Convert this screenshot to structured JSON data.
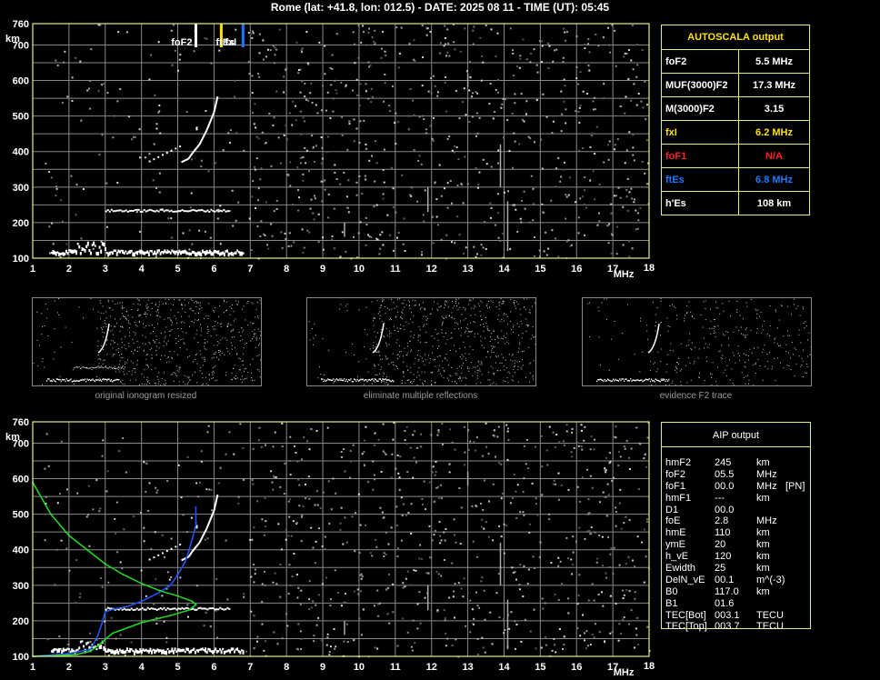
{
  "header": {
    "text": "Rome (lat: +41.8, lon: 012.5) - DATE: 2025 08 11 - TIME (UT): 05:45"
  },
  "colors": {
    "grid": "#888888",
    "frame": "#e6f07a",
    "trace": "#ffffff",
    "foF2": "#ffffff",
    "fxI": "#ffe100",
    "ftEs": "#1e78ff",
    "model": "#22dd22",
    "profile": "#2255ff"
  },
  "chart_data": [
    {
      "type": "scatter",
      "id": "ionogram-top",
      "xlabel": "MHz",
      "ylabel": "km",
      "xlim": [
        1,
        18
      ],
      "ylim": [
        100,
        760
      ],
      "x_ticks": [
        "1",
        "2",
        "3",
        "4",
        "5",
        "6",
        "7",
        "8",
        "9",
        "10",
        "11",
        "12",
        "13",
        "14",
        "15",
        "16",
        "17",
        "18"
      ],
      "y_ticks": [
        "100",
        "200",
        "300",
        "400",
        "500",
        "600",
        "700",
        "760"
      ],
      "markers": [
        {
          "label": "foF2",
          "x": 5.5,
          "color": "#ffffff"
        },
        {
          "label": "fxI",
          "x": 6.2,
          "color": "#ffe100"
        },
        {
          "label": "ftEs",
          "x": 6.8,
          "color": "#1e78ff"
        }
      ],
      "traces": {
        "es_layer": {
          "x_start": 1.5,
          "x_end": 6.8,
          "height_km": 120
        },
        "es_multiple": {
          "x_start": 3.0,
          "x_end": 6.4,
          "height_km": 236
        },
        "f2_trace": [
          [
            5.1,
            370
          ],
          [
            5.3,
            380
          ],
          [
            5.4,
            395
          ],
          [
            5.6,
            420
          ],
          [
            5.8,
            460
          ],
          [
            6.0,
            510
          ],
          [
            6.1,
            555
          ]
        ],
        "f2_lower": [
          [
            5.0,
            480
          ],
          [
            4.8,
            440
          ],
          [
            4.6,
            410
          ],
          [
            4.4,
            395
          ],
          [
            4.3,
            385
          ],
          [
            4.2,
            380
          ]
        ]
      }
    },
    {
      "type": "scatter",
      "id": "ionogram-bottom",
      "xlabel": "MHz",
      "ylabel": "km",
      "xlim": [
        1,
        18
      ],
      "ylim": [
        100,
        760
      ],
      "x_ticks": [
        "1",
        "2",
        "3",
        "4",
        "5",
        "6",
        "7",
        "8",
        "9",
        "10",
        "11",
        "12",
        "13",
        "14",
        "15",
        "16",
        "17",
        "18"
      ],
      "y_ticks": [
        "100",
        "200",
        "300",
        "400",
        "500",
        "600",
        "700",
        "760"
      ],
      "series": [
        {
          "name": "",
          "color": "#2255ff",
          "points": [
            [
              1.0,
              100
            ],
            [
              2.0,
              108
            ],
            [
              2.6,
              120
            ],
            [
              2.8,
              160
            ],
            [
              2.9,
              190
            ],
            [
              3.0,
              225
            ],
            [
              3.2,
              232
            ],
            [
              3.6,
              240
            ],
            [
              4.0,
              255
            ],
            [
              4.4,
              275
            ],
            [
              4.8,
              300
            ],
            [
              5.0,
              330
            ],
            [
              5.2,
              365
            ],
            [
              5.3,
              395
            ],
            [
              5.4,
              430
            ],
            [
              5.5,
              470
            ],
            [
              5.5,
              520
            ]
          ]
        },
        {
          "name": "",
          "color": "#22dd22",
          "points": [
            [
              1.0,
              590
            ],
            [
              1.5,
              500
            ],
            [
              2.0,
              440
            ],
            [
              2.5,
              400
            ],
            [
              3.0,
              360
            ],
            [
              3.5,
              330
            ],
            [
              4.0,
              305
            ],
            [
              4.5,
              285
            ],
            [
              5.0,
              270
            ],
            [
              5.4,
              255
            ],
            [
              5.5,
              245
            ],
            [
              5.3,
              230
            ],
            [
              4.8,
              215
            ],
            [
              4.0,
              195
            ],
            [
              3.2,
              165
            ],
            [
              2.8,
              130
            ],
            [
              2.6,
              115
            ],
            [
              2.2,
              105
            ],
            [
              1.5,
              101
            ],
            [
              1.0,
              100
            ]
          ]
        }
      ]
    }
  ],
  "autoscala": {
    "title": "AUTOSCALA output",
    "rows": [
      {
        "label": "foF2",
        "value": "5.5 MHz",
        "color": "#ffffff"
      },
      {
        "label": "MUF(3000)F2",
        "value": "17.3 MHz",
        "color": "#ffffff"
      },
      {
        "label": "M(3000)F2",
        "value": "3.15",
        "color": "#ffffff"
      },
      {
        "label": "fxI",
        "value": "6.2 MHz",
        "color": "#ffe100"
      },
      {
        "label": "foF1",
        "value": "N/A",
        "color": "#ff2020"
      },
      {
        "label": "ftEs",
        "value": "6.8 MHz",
        "color": "#1e78ff"
      },
      {
        "label": "h'Es",
        "value": "108      km",
        "color": "#ffffff"
      }
    ]
  },
  "thumbnails": [
    {
      "caption": "original ionogram resized"
    },
    {
      "caption": "eliminate multiple reflections"
    },
    {
      "caption": "evidence F2 trace"
    }
  ],
  "aip": {
    "title": "AIP output",
    "rows": [
      {
        "name": "hmF2",
        "value": "245",
        "unit": "km",
        "extra": ""
      },
      {
        "name": "foF2",
        "value": "05.5",
        "unit": "MHz",
        "extra": ""
      },
      {
        "name": "foF1",
        "value": "00.0",
        "unit": "MHz",
        "extra": "[PN]"
      },
      {
        "name": "hmF1",
        "value": "---",
        "unit": "km",
        "extra": ""
      },
      {
        "name": "D1",
        "value": "00.0",
        "unit": "",
        "extra": ""
      },
      {
        "name": "foE",
        "value": "2.8",
        "unit": "MHz",
        "extra": ""
      },
      {
        "name": "hmE",
        "value": "110",
        "unit": "km",
        "extra": ""
      },
      {
        "name": "ymE",
        "value": "20",
        "unit": "km",
        "extra": ""
      },
      {
        "name": "h_vE",
        "value": "120",
        "unit": "km",
        "extra": ""
      },
      {
        "name": "Ewidth",
        "value": "25",
        "unit": "km",
        "extra": ""
      },
      {
        "name": "DelN_vE",
        "value": "00.1",
        "unit": "m^(-3)",
        "extra": ""
      },
      {
        "name": "B0",
        "value": "117.0",
        "unit": "km",
        "extra": ""
      },
      {
        "name": "B1",
        "value": "01.6",
        "unit": "",
        "extra": ""
      },
      {
        "name": "TEC[Bot]",
        "value": "003.1",
        "unit": "TECU",
        "extra": ""
      },
      {
        "name": "TEC[Top]",
        "value": "003.7",
        "unit": "TECU",
        "extra": ""
      }
    ]
  }
}
